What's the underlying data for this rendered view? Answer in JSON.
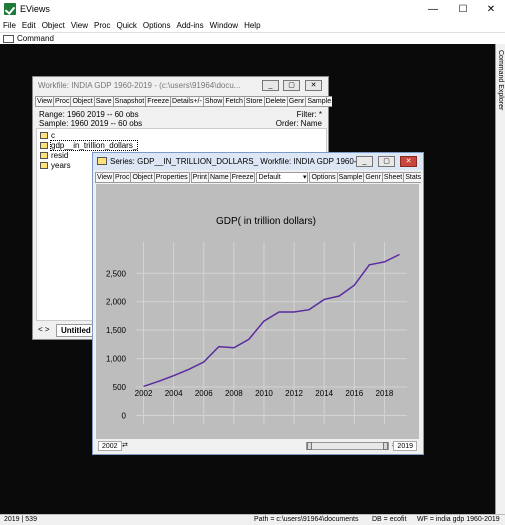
{
  "app": {
    "title": "EViews",
    "minimize": "—",
    "maximize": "☐",
    "close": "✕"
  },
  "menu": [
    "File",
    "Edit",
    "Object",
    "View",
    "Proc",
    "Quick",
    "Options",
    "Add-ins",
    "Window",
    "Help"
  ],
  "command_tab": "Command",
  "right_panel": "Command Explorer",
  "workfile": {
    "title": "Workfile: INDIA GDP 1960-2019 - (c:\\users\\91964\\docu...",
    "toolbar": [
      "View",
      "Proc",
      "Object",
      "Save",
      "Snapshot",
      "Freeze",
      "Details+/-",
      "Show",
      "Fetch",
      "Store",
      "Delete",
      "Genr",
      "Sample"
    ],
    "range": "Range:  1960 2019  --  60 obs",
    "sample": "Sample: 1960 2019  --  60 obs",
    "filter": "Filter: *",
    "order": "Order: Name",
    "objects": [
      "c",
      "gdp__in_trillion_dollars_",
      "resid",
      "years"
    ],
    "tab_arrows": "< >",
    "tab": "Untitled"
  },
  "series": {
    "title": "Series: GDP__IN_TRILLION_DOLLARS_   Workfile: INDIA GDP 1960-...",
    "toolbar": [
      "View",
      "Proc",
      "Object",
      "Properties",
      "Print",
      "Name",
      "Freeze"
    ],
    "toolbar_select": "Default",
    "toolbar2": [
      "Options",
      "Sample",
      "Genr",
      "Sheet",
      "Stats",
      "I"
    ],
    "bottom_left": "2002",
    "bottom_right": "2019"
  },
  "chart_data": {
    "type": "line",
    "title": "GDP( in trillion dollars)",
    "x": [
      2002,
      2003,
      2004,
      2005,
      2006,
      2007,
      2008,
      2009,
      2010,
      2011,
      2012,
      2013,
      2014,
      2015,
      2016,
      2017,
      2018,
      2019
    ],
    "y": [
      510,
      600,
      700,
      810,
      940,
      1210,
      1190,
      1340,
      1660,
      1820,
      1820,
      1860,
      2040,
      2100,
      2290,
      2650,
      2700,
      2830
    ],
    "xlim": [
      2001.5,
      2019.5
    ],
    "ylim": [
      -150,
      3050
    ],
    "yticks": [
      0,
      500,
      1000,
      1500,
      2000,
      2500
    ],
    "ytick_labels": [
      "0",
      "500",
      "1,000",
      "1,500",
      "2,000",
      "2,500"
    ],
    "xticks": [
      2002,
      2004,
      2006,
      2008,
      2010,
      2012,
      2014,
      2016,
      2018
    ],
    "grid": true,
    "line_color": "#5a2ca0",
    "background": "#bdbdbd"
  },
  "status": {
    "left": "2019  |  539",
    "path": "Path = c:\\users\\91964\\documents",
    "db": "DB = ecofit",
    "wf": "WF = india gdp 1960-2019"
  }
}
